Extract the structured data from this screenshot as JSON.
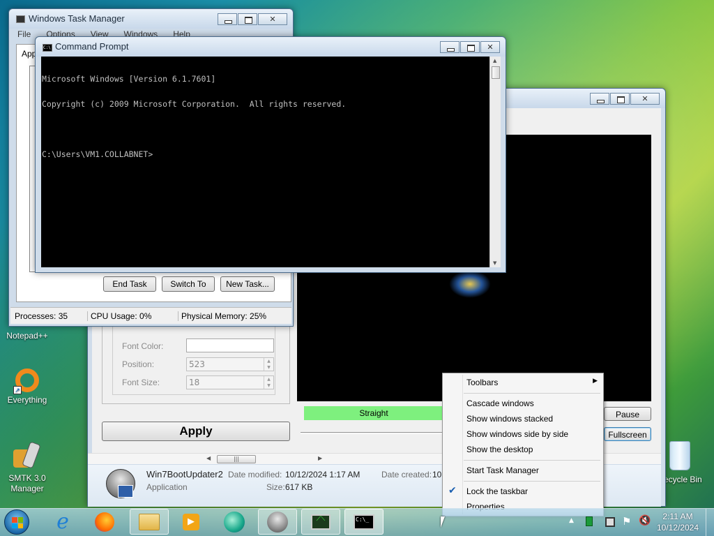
{
  "desktop": {
    "icons": [
      {
        "label": "Notepad++",
        "icon": "notepadpp-icon"
      },
      {
        "label": "Everything",
        "icon": "everything-icon"
      },
      {
        "label": "SMTK 3.0 Manager",
        "icon": "smtk-icon"
      },
      {
        "label": "Recycle Bin",
        "icon": "recycle-bin-icon"
      }
    ]
  },
  "task_manager": {
    "title": "Windows Task Manager",
    "menu": [
      "File",
      "Options",
      "View",
      "Windows",
      "Help"
    ],
    "tab_partial": "App",
    "buttons": {
      "end_task": "End Task",
      "switch_to": "Switch To",
      "new_task": "New Task..."
    },
    "status": {
      "processes": "Processes: 35",
      "cpu": "CPU Usage: 0%",
      "memory": "Physical Memory: 25%"
    }
  },
  "cmd": {
    "title": "Command Prompt",
    "lines": [
      "Microsoft Windows [Version 6.1.7601]",
      "Copyright (c) 2009 Microsoft Corporation.  All rights reserved.",
      "",
      "C:\\Users\\VM1.COLLABNET>"
    ]
  },
  "boot_updater": {
    "font_color_label": "Font Color:",
    "position_label": "Position:",
    "position_value": "523",
    "font_size_label": "Font Size:",
    "font_size_value": "18",
    "apply_label": "Apply",
    "straight_label": "Straight",
    "pause_label": "Pause",
    "fullscreen_label": "Fullscreen",
    "hscroll_grip": "|||"
  },
  "details_pane": {
    "file_name": "Win7BootUpdater2",
    "file_type": "Application",
    "date_modified_label": "Date modified:",
    "date_modified_value": "10/12/2024 1:17 AM",
    "size_label": "Size:",
    "size_value": "617 KB",
    "date_created_label": "Date created:",
    "date_created_value": "10"
  },
  "context_menu": {
    "items": [
      {
        "label": "Toolbars",
        "submenu": true
      },
      {
        "label": "Cascade windows"
      },
      {
        "label": "Show windows stacked"
      },
      {
        "label": "Show windows side by side"
      },
      {
        "label": "Show the desktop"
      },
      {
        "label": "Start Task Manager"
      },
      {
        "label": "Lock the taskbar",
        "checked": true
      },
      {
        "label": "Properties"
      }
    ]
  },
  "taskbar": {
    "time": "2:11 AM",
    "date": "10/12/2024",
    "apps": [
      "start-orb-icon",
      "internet-explorer-icon",
      "firefox-icon",
      "explorer-folder-icon",
      "media-player-icon",
      "edge-like-icon",
      "win7bootupdater-icon",
      "task-manager-icon",
      "command-prompt-icon"
    ],
    "cmd_glyph": "C:\\_"
  },
  "colors": {
    "straight_bar": "#7ef07e",
    "console_bg": "#000000",
    "console_fg": "#c0c0c0"
  }
}
